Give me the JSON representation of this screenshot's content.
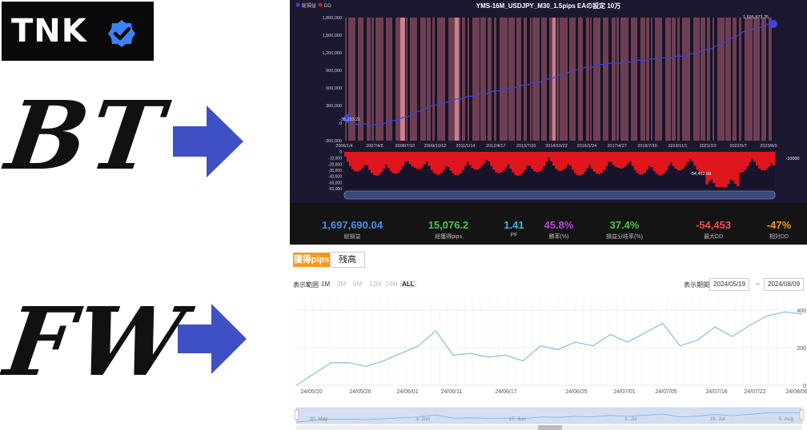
{
  "logo": {
    "text": "TNK"
  },
  "labels": {
    "bt": "BT",
    "fw": "FW"
  },
  "colors": {
    "arrow": "#3f4fc4",
    "equity": "#3b45e0",
    "dd": "#e0161e",
    "fw_line": "#8cc3ea",
    "tab_active": "#f39a1e"
  },
  "bt": {
    "title": "YMS-16M_USDJPY_M30_1.5pips EAの設定 10万",
    "legend": [
      "総損益",
      "DD"
    ],
    "start_label": "-35,233.21",
    "end_label": "1,695,873.25",
    "dd_label": "-54,452.58",
    "dd_right": "-10000",
    "yticks": [
      "1,800,000",
      "1,500,000",
      "1,200,000",
      "900,000",
      "600,000",
      "300,000",
      "0",
      "-300,000"
    ],
    "xticks": [
      "2006/1/4",
      "2007/4/8",
      "2008/7/10",
      "2009/10/12",
      "2011/1/14",
      "2012/4/17",
      "2013/7/20",
      "2014/10/22",
      "2016/1/24",
      "2017/4/27",
      "2018/7/30",
      "2019/11/1",
      "2021/2/2",
      "2022/5/7",
      "2023/8/9"
    ],
    "dd_yticks": [
      "0",
      "-10,000",
      "-20,000",
      "-30,000",
      "-40,000",
      "-50,000",
      "-60,000"
    ],
    "stats": [
      {
        "value": "1,697,690.04",
        "label": "総損益",
        "color": "#4a8df0"
      },
      {
        "value": "15,076.2",
        "label": "総獲得pips",
        "color": "#4cc24c"
      },
      {
        "value": "1.41",
        "label": "PF",
        "color": "#3fb6e6"
      },
      {
        "value": "45.8%",
        "label": "勝率(%)",
        "color": "#b54ad8"
      },
      {
        "value": "37.4%",
        "label": "損益分岐率(%)",
        "color": "#4cc24c"
      },
      {
        "value": "-54,453",
        "label": "最大DD",
        "color": "#f2494a"
      },
      {
        "value": "-47%",
        "label": "相対DD",
        "color": "#f39a1e"
      }
    ]
  },
  "fw": {
    "tabs": [
      "獲得pips",
      "残高"
    ],
    "range_label": "表示範囲",
    "ranges": [
      "1M",
      "3M",
      "6M",
      "12M",
      "24M",
      "ALL"
    ],
    "period_label": "表示期間",
    "date_from": "2024/05/19",
    "date_sep": "~",
    "date_to": "2024/08/09",
    "xticks": [
      "24/05/20",
      "24/05/26",
      "24/06/01",
      "24/06/11",
      "24/06/17",
      "24/06/25",
      "24/07/01",
      "24/07/05",
      "24/07/16",
      "24/07/22",
      "24/08/06"
    ],
    "yticks": [
      "400",
      "200",
      "0"
    ],
    "nav_ticks": [
      "20. May",
      "3. Jun",
      "17. Jun",
      "1. Jul",
      "15. Jul",
      "5. Aug"
    ]
  },
  "chart_data": [
    {
      "type": "line",
      "title": "YMS-16M_USDJPY_M30_1.5pips EAの設定 10万",
      "series": [
        {
          "name": "総損益",
          "x": [
            "2006/1/4",
            "2007/4/8",
            "2008/7/10",
            "2009/10/12",
            "2011/1/14",
            "2012/4/17",
            "2013/7/20",
            "2014/10/22",
            "2016/1/24",
            "2017/4/27",
            "2018/7/30",
            "2019/11/1",
            "2021/2/2",
            "2022/5/7",
            "2023/8/9",
            "2024/3/1"
          ],
          "values": [
            0,
            -35233,
            90000,
            300000,
            420000,
            520000,
            620000,
            730000,
            900000,
            1000000,
            1050000,
            1100000,
            1150000,
            1300000,
            1550000,
            1697690
          ]
        }
      ],
      "ylim": [
        -300000,
        1800000
      ]
    },
    {
      "type": "line",
      "title": "",
      "series": [
        {
          "name": "獲得pips",
          "values": [
            0,
            60,
            120,
            120,
            100,
            130,
            170,
            210,
            290,
            160,
            170,
            150,
            160,
            130,
            210,
            190,
            230,
            210,
            270,
            230,
            280,
            330,
            210,
            240,
            310,
            260,
            320,
            370,
            390,
            380
          ]
        }
      ],
      "x_start": "24/05/20",
      "x_end": "24/08/09",
      "ylim": [
        0,
        460
      ]
    }
  ]
}
